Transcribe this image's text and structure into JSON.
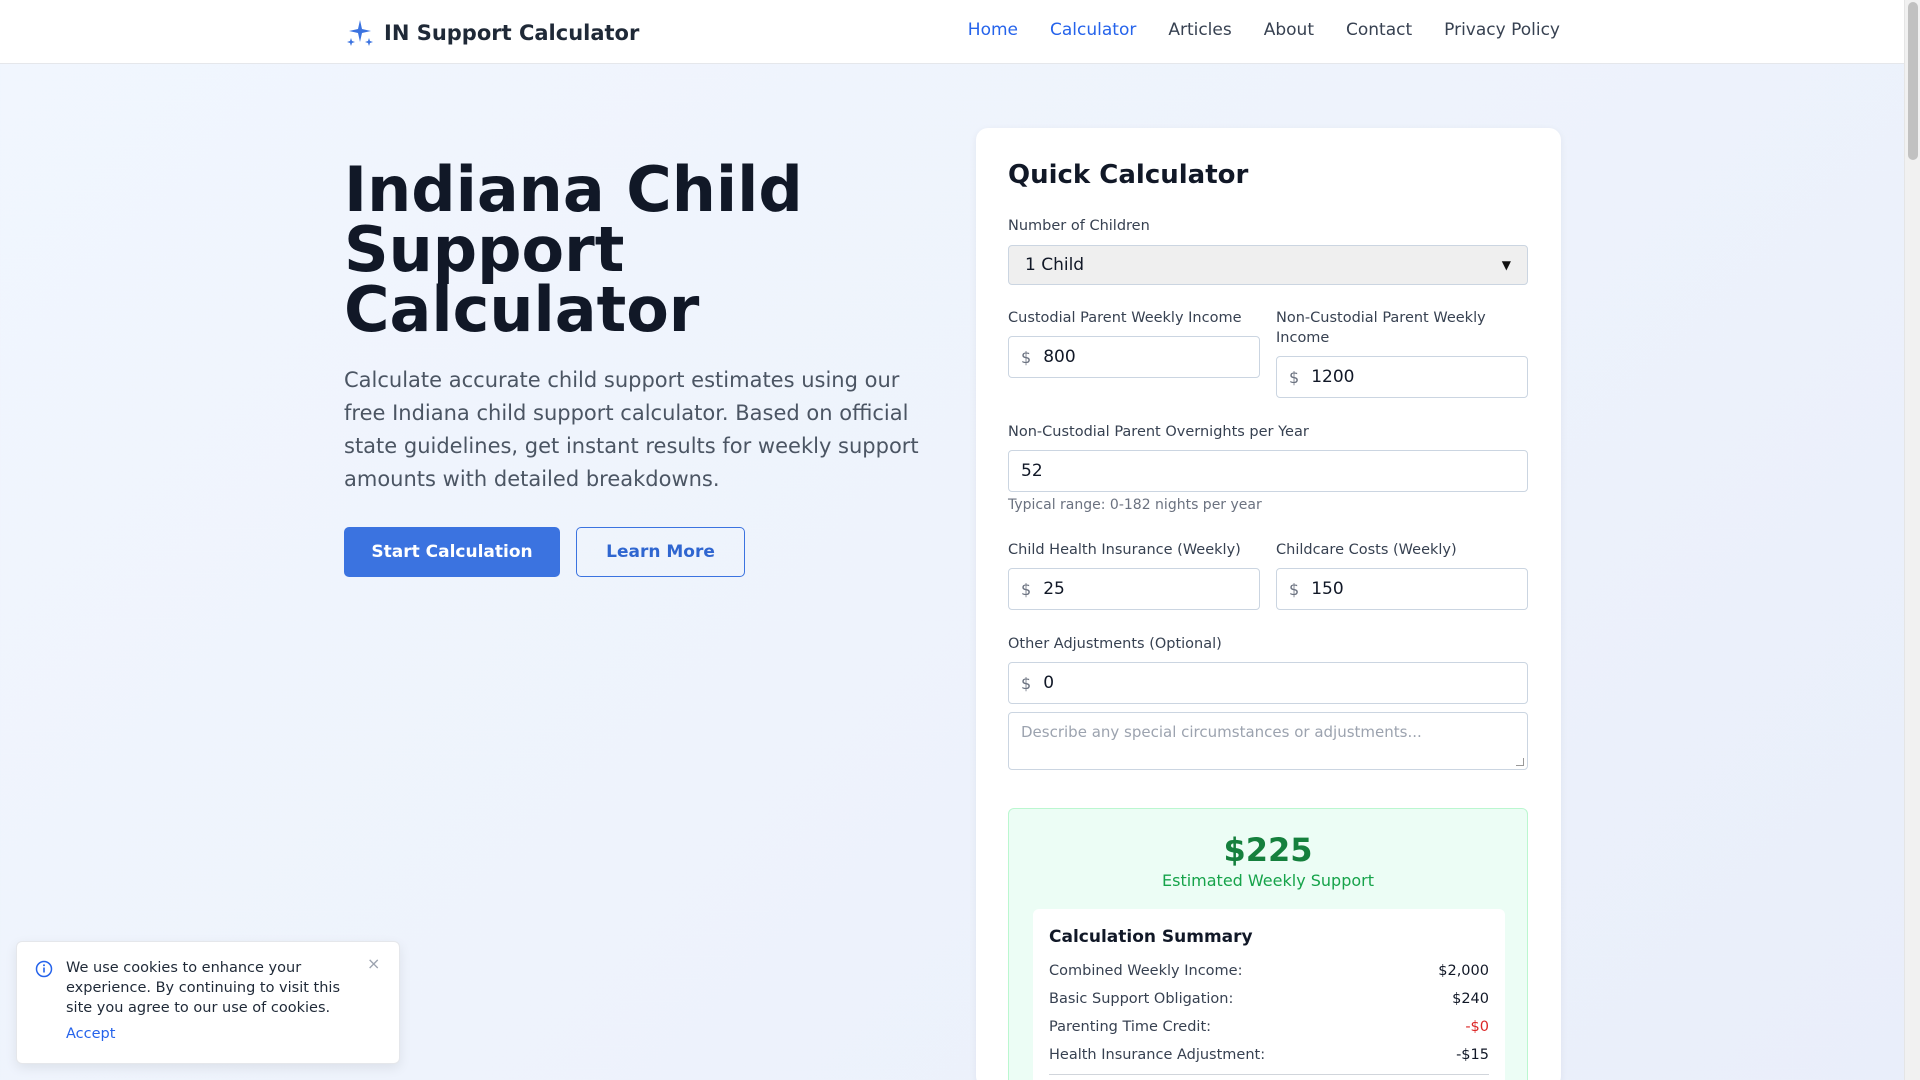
{
  "header": {
    "brand": "IN Support Calculator",
    "nav": [
      "Home",
      "Calculator",
      "Articles",
      "About",
      "Contact",
      "Privacy Policy"
    ]
  },
  "hero": {
    "title_line1": "Indiana Child",
    "title_line2": "Support",
    "title_line3": "Calculator",
    "description": "Calculate accurate child support estimates using our free Indiana child support calculator. Based on official state guidelines, get instant results for weekly support amounts with detailed breakdowns.",
    "start_button": "Start Calculation",
    "learn_button": "Learn More"
  },
  "calculator": {
    "title": "Quick Calculator",
    "children_label": "Number of Children",
    "children_value": "1 Child",
    "custodial_label": "Custodial Parent Weekly Income",
    "custodial_value": "800",
    "noncustodial_label": "Non-Custodial Parent Weekly Income",
    "noncustodial_value": "1200",
    "overnights_label": "Non-Custodial Parent Overnights per Year",
    "overnights_value": "52",
    "overnights_hint": "Typical range: 0-182 nights per year",
    "insurance_label": "Child Health Insurance (Weekly)",
    "insurance_value": "25",
    "childcare_label": "Childcare Costs (Weekly)",
    "childcare_value": "150",
    "other_label": "Other Adjustments (Optional)",
    "other_value": "0",
    "notes_placeholder": "Describe any special circumstances or adjustments...",
    "currency_symbol": "$"
  },
  "result": {
    "amount": "$225",
    "label": "Estimated Weekly Support",
    "summary_title": "Calculation Summary",
    "rows": [
      {
        "label": "Combined Weekly Income:",
        "value": "$2,000"
      },
      {
        "label": "Basic Support Obligation:",
        "value": "$240"
      },
      {
        "label": "Parenting Time Credit:",
        "value": "-$0"
      },
      {
        "label": "Health Insurance Adjustment:",
        "value": "-$15"
      }
    ]
  },
  "cookie": {
    "text": "We use cookies to enhance your experience. By continuing to visit this site you agree to our use of cookies.",
    "close": "×",
    "accept": "Accept"
  },
  "colors": {
    "accent": "#3b73e0",
    "success": "#15803d",
    "danger": "#dc2626"
  },
  "icons": {
    "brand": "sparkles-icon",
    "cookie": "info-icon",
    "select": "chevron-down-icon"
  }
}
